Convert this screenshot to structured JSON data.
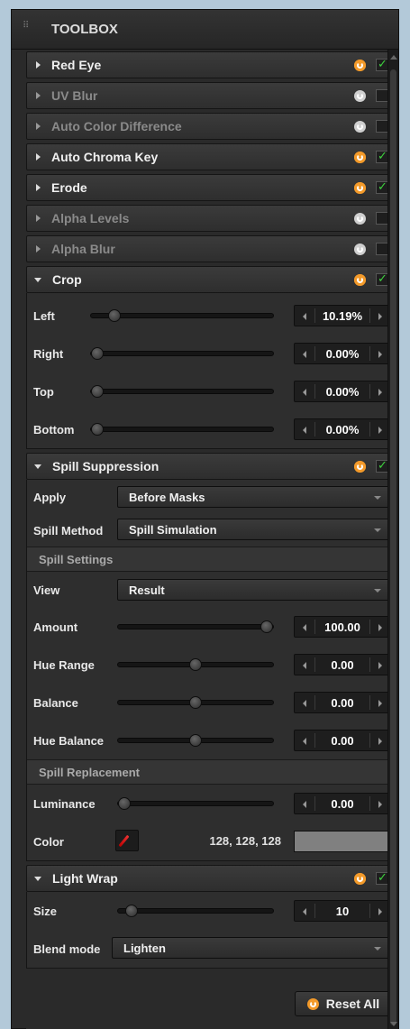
{
  "title": "TOOLBOX",
  "colors": {
    "accent": "#f39a2a",
    "check": "#3ed13e",
    "swatch": "#808080"
  },
  "effects": [
    {
      "label": "Red Eye",
      "enabled": true
    },
    {
      "label": "UV Blur",
      "enabled": false
    },
    {
      "label": "Auto Color Difference",
      "enabled": false
    },
    {
      "label": "Auto Chroma Key",
      "enabled": true
    },
    {
      "label": "Erode",
      "enabled": true
    },
    {
      "label": "Alpha Levels",
      "enabled": false
    },
    {
      "label": "Alpha Blur",
      "enabled": false
    }
  ],
  "crop": {
    "label": "Crop",
    "enabled": true,
    "rows": [
      {
        "label": "Left",
        "value": "10.19%",
        "level": 0.1019
      },
      {
        "label": "Right",
        "value": "0.00%",
        "level": 0
      },
      {
        "label": "Top",
        "value": "0.00%",
        "level": 0
      },
      {
        "label": "Bottom",
        "value": "0.00%",
        "level": 0
      }
    ]
  },
  "spill": {
    "label": "Spill Suppression",
    "enabled": true,
    "apply_label": "Apply",
    "apply_value": "Before Masks",
    "method_label": "Spill Method",
    "method_value": "Spill Simulation",
    "settings_label": "Spill Settings",
    "view_label": "View",
    "view_value": "Result",
    "rows": [
      {
        "label": "Amount",
        "value": "100.00",
        "level": 1.0
      },
      {
        "label": "Hue Range",
        "value": "0.00",
        "level": 0.5
      },
      {
        "label": "Balance",
        "value": "0.00",
        "level": 0.5
      },
      {
        "label": "Hue Balance",
        "value": "0.00",
        "level": 0.5
      }
    ],
    "replacement_label": "Spill Replacement",
    "luminance_label": "Luminance",
    "luminance_value": "0.00",
    "luminance_level": 0,
    "color_label": "Color",
    "color_rgb": "128, 128, 128"
  },
  "lightwrap": {
    "label": "Light Wrap",
    "enabled": true,
    "size_label": "Size",
    "size_value": "10",
    "size_level": 0.05,
    "blend_label": "Blend mode",
    "blend_value": "Lighten"
  },
  "reset_all_label": "Reset All"
}
